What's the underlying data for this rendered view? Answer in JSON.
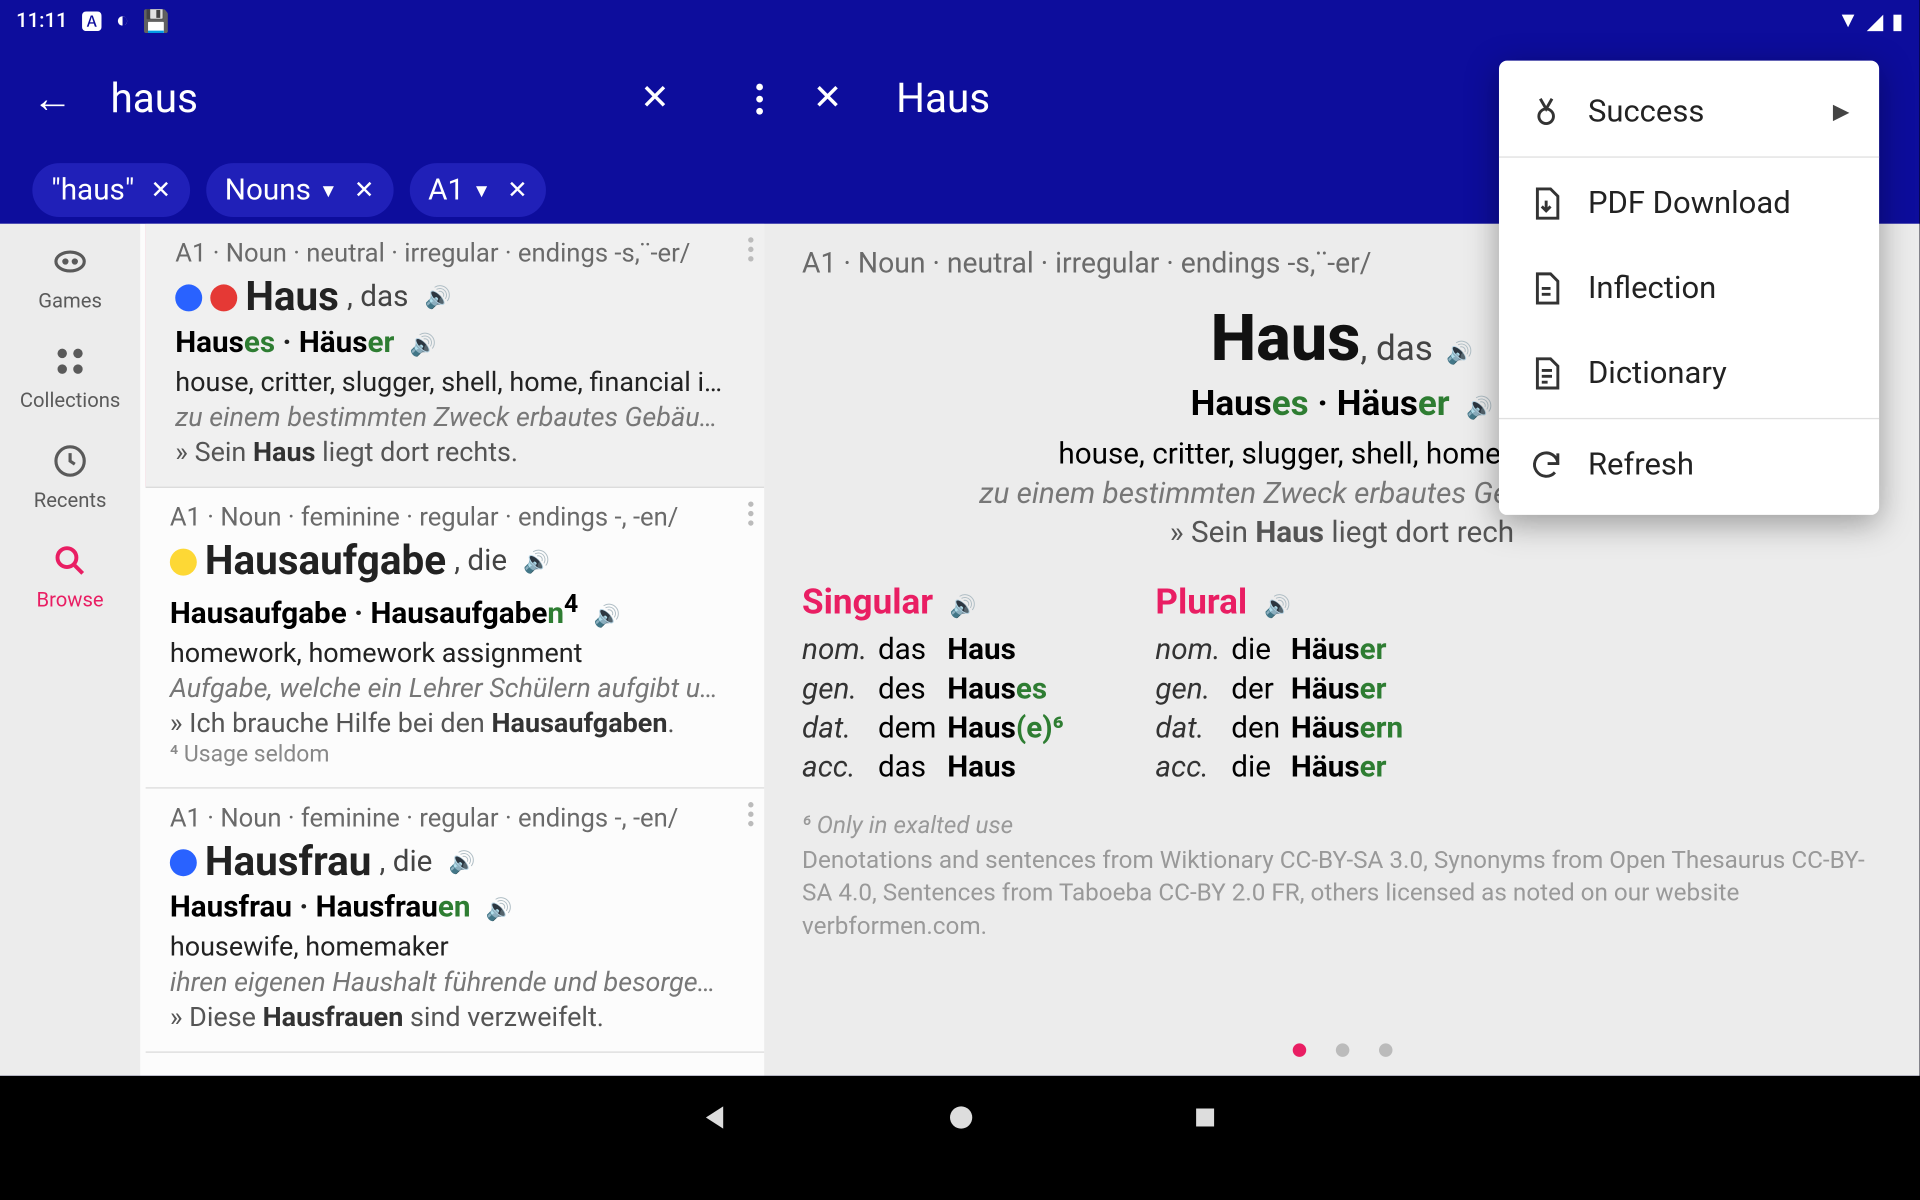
{
  "status": {
    "time": "11:11"
  },
  "search": {
    "value": "haus"
  },
  "chips": [
    {
      "label": "\"haus\""
    },
    {
      "label": "Nouns"
    },
    {
      "label": "A1"
    }
  ],
  "nav": {
    "games": "Games",
    "collections": "Collections",
    "recents": "Recents",
    "browse": "Browse"
  },
  "list": [
    {
      "meta": "A1 · Noun · neutral · irregular · endings -s,¨-er/",
      "dots": [
        "blue",
        "red"
      ],
      "word": "Haus",
      "article": ", das",
      "forms_html": "Haus<span class='suf'>es</span> <span class='sep'>·</span> Häus<span class='suf'>er</span>",
      "gloss": "house, critter, slugger, shell, home, financial i…",
      "def": "zu einem bestimmten Zweck erbautes Gebäu…",
      "ex_pre": "» Sein ",
      "ex_bold": "Haus",
      "ex_post": " liegt dort rechts."
    },
    {
      "meta": "A1 · Noun · feminine · regular · endings -, -en/",
      "dots": [
        "yellow"
      ],
      "word": "Hausaufgabe",
      "article": ", die",
      "forms_html": "Hausaufgabe <span class='sep'>·</span> Hausaufgabe<span class='suf'>n</span><sup>4</sup>",
      "gloss": "homework, homework assignment",
      "def": "Aufgabe, welche ein Lehrer Schülern aufgibt u…",
      "ex_pre": "» Ich brauche Hilfe bei den ",
      "ex_bold": "Hausaufgaben",
      "ex_post": ".",
      "note": "⁴ Usage seldom"
    },
    {
      "meta": "A1 · Noun · feminine · regular · endings -, -en/",
      "dots": [
        "blue"
      ],
      "word": "Hausfrau",
      "article": ", die",
      "forms_html": "Hausfrau <span class='sep'>·</span> Hausfrau<span class='suf'>en</span>",
      "gloss": "housewife, homemaker",
      "def": "ihren eigenen Haushalt führende und besorge…",
      "ex_pre": "» Diese ",
      "ex_bold": "Hausfrauen",
      "ex_post": " sind verzweifelt."
    }
  ],
  "detail": {
    "title": "Haus",
    "meta": "A1 · Noun · neutral · irregular · endings -s,¨-er/",
    "word": "Haus",
    "article": ", das",
    "forms_html": "Haus<span class='suf'>es</span> · Häus<span class='suf'>er</span>",
    "gloss": "house, critter, slugger, shell, home, financial",
    "def": "zu einem bestimmten Zweck erbautes Gebäude, zum Wo",
    "ex_pre": "» Sein ",
    "ex_bold": "Haus",
    "ex_post": " liegt dort rech",
    "tables": {
      "singular": {
        "title": "Singular",
        "rows": [
          [
            "nom.",
            "das",
            "Haus",
            ""
          ],
          [
            "gen.",
            "des",
            "Haus",
            "es"
          ],
          [
            "dat.",
            "dem",
            "Haus",
            "(e)⁶"
          ],
          [
            "acc.",
            "das",
            "Haus",
            ""
          ]
        ]
      },
      "plural": {
        "title": "Plural",
        "rows": [
          [
            "nom.",
            "die",
            "Häus",
            "er"
          ],
          [
            "gen.",
            "der",
            "Häus",
            "er"
          ],
          [
            "dat.",
            "den",
            "Häus",
            "ern"
          ],
          [
            "acc.",
            "die",
            "Häus",
            "er"
          ]
        ]
      }
    },
    "footnote": "⁶ Only in exalted use",
    "credits": "Denotations and sentences from Wiktionary CC-BY-SA 3.0, Synonyms from Open Thesaurus CC-BY-SA 4.0, Sentences from Taboeba CC-BY 2.0 FR, others licensed as noted on our website verbformen.com."
  },
  "menu": {
    "success": "Success",
    "pdf": "PDF Download",
    "inflection": "Inflection",
    "dictionary": "Dictionary",
    "refresh": "Refresh"
  }
}
